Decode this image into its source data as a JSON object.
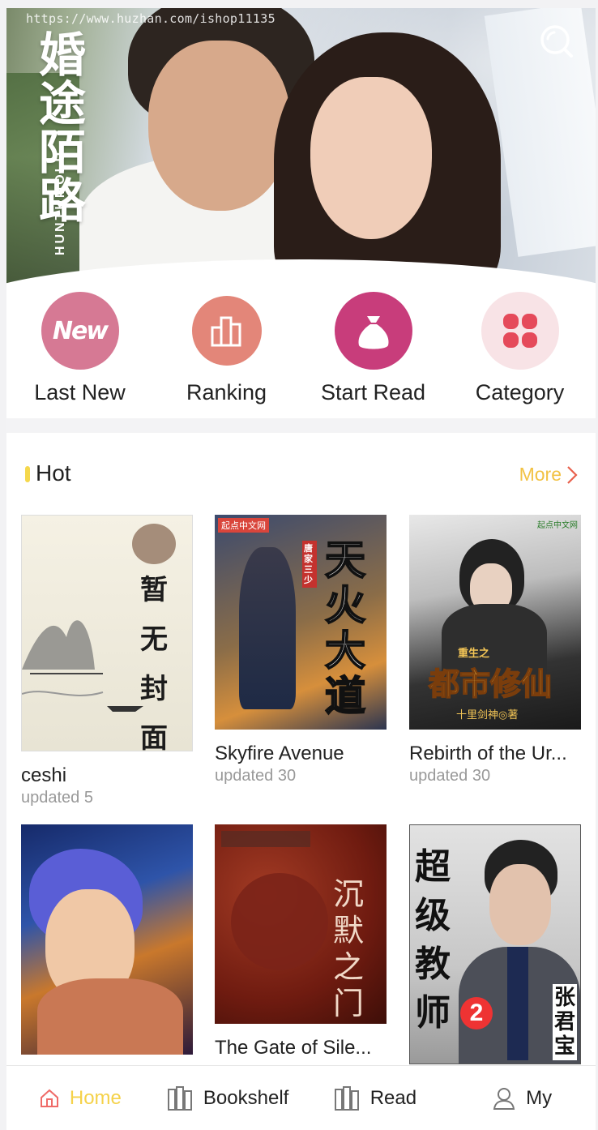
{
  "banner": {
    "watermark": "https://www.huzhan.com/ishop11135",
    "title_chars": [
      "婚",
      "途",
      "陌",
      "路"
    ],
    "subtitle": "HUNTUMOLU"
  },
  "quick_nav": [
    {
      "label": "Last New",
      "icon": "new-badge-icon",
      "badge_text": "New",
      "color": "#d67994"
    },
    {
      "label": "Ranking",
      "icon": "bar-chart-icon",
      "color": "#e38679"
    },
    {
      "label": "Start Read",
      "icon": "money-bag-icon",
      "color": "#c83d7b"
    },
    {
      "label": "Category",
      "icon": "four-petal-grid-icon",
      "color": "#f8e3e6"
    }
  ],
  "hot": {
    "title": "Hot",
    "more_label": "More"
  },
  "books": [
    {
      "title": "ceshi",
      "updated": "updated 5",
      "cover_text": [
        "暂",
        "无",
        "封",
        "面"
      ]
    },
    {
      "title": "Skyfire Avenue",
      "updated": "updated 30",
      "cover_text": [
        "天",
        "火",
        "大",
        "道"
      ],
      "cover_author": "唐家三少",
      "cover_publisher": "起点中文网"
    },
    {
      "title": "Rebirth of the Ur...",
      "updated": "updated 30",
      "cover_text": "都市修仙",
      "cover_prefix": "重生之",
      "cover_author": "十里剑神◎著",
      "cover_publisher": "起点中文网"
    },
    {
      "title": "",
      "updated": ""
    },
    {
      "title": "The Gate of Sile...",
      "updated": "",
      "cover_text": [
        "沉",
        "默",
        "之",
        "门"
      ]
    },
    {
      "title": "",
      "updated": "",
      "cover_text": [
        "超",
        "级",
        "教",
        "师"
      ],
      "cover_author": "张君宝",
      "cover_number": "2"
    }
  ],
  "tabbar": [
    {
      "label": "Home",
      "icon": "home-icon",
      "active": true
    },
    {
      "label": "Bookshelf",
      "icon": "bookshelf-icon",
      "active": false
    },
    {
      "label": "Read",
      "icon": "book-read-icon",
      "active": false
    },
    {
      "label": "My",
      "icon": "user-icon",
      "active": false
    }
  ],
  "colors": {
    "accent": "#f5d24a",
    "more": "#f2c244",
    "more_chevron": "#e8604c",
    "muted": "#999999"
  }
}
